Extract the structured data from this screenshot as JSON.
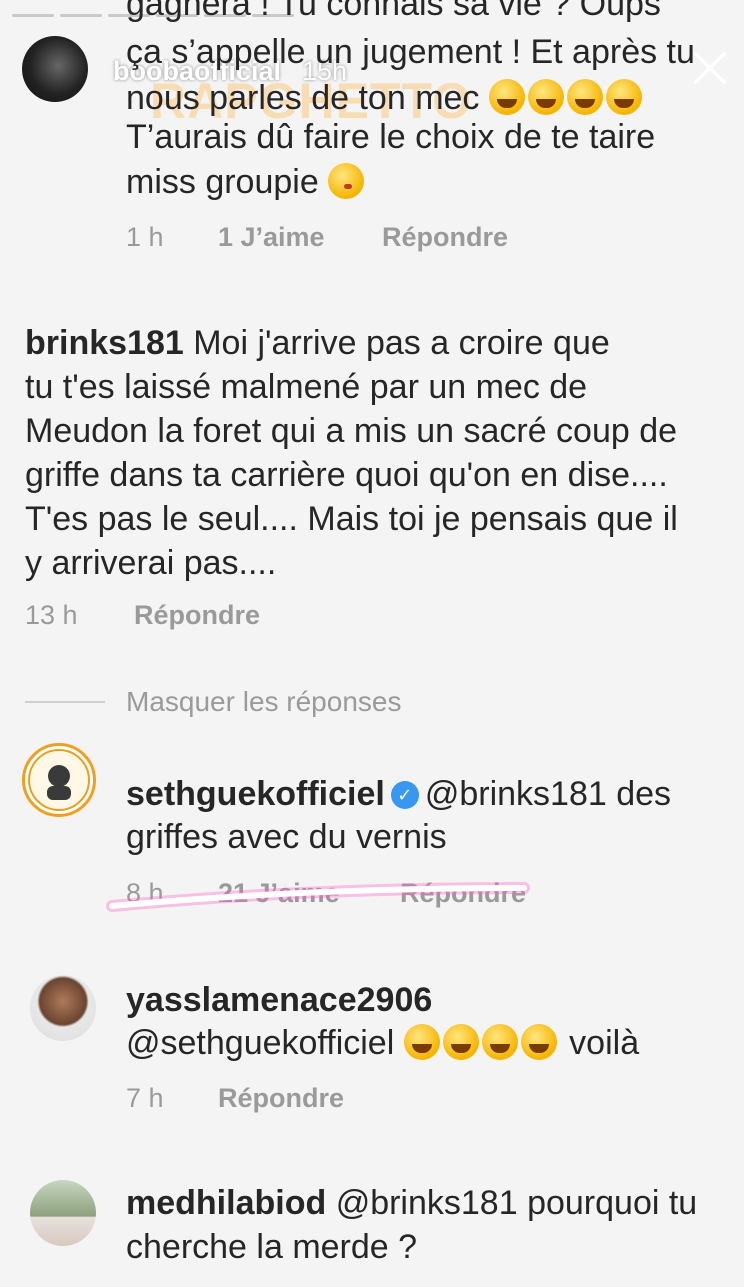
{
  "story": {
    "username": "boobaofficial",
    "time": "15h",
    "watermark": "RAPGHETTO"
  },
  "comment1": {
    "line0": "gagnera ! Tu connais sa vie ? Oups",
    "line1": "ça s’appelle un jugement ! Et après tu",
    "line2": "nous parles de ton mec",
    "line3": "T’aurais dû faire le choix de te taire",
    "line4": "miss groupie",
    "time": "1 h",
    "likes": "1 J’aime",
    "reply": "Répondre"
  },
  "comment2": {
    "user": "brinks181",
    "line1": "Moi j'arrive pas a croire que",
    "line2": "tu t'es laissé malmené par un mec de",
    "line3": "Meudon la foret qui a mis un sacré coup de",
    "line4": "griffe dans ta carrière quoi qu'on en dise....",
    "line5": "T'es pas le seul.... Mais toi je pensais que il",
    "line6": "y arriverai pas....",
    "time": "13 h",
    "reply": "Répondre"
  },
  "hide_replies": "Masquer les réponses",
  "reply1": {
    "user": "sethguekofficiel",
    "mention": "@brinks181",
    "text_a": "des",
    "text_b": "griffes avec du vernis",
    "time": "8 h",
    "likes": "21 J’aime",
    "reply": "Répondre",
    "highlight_color": "#ff5fc8"
  },
  "reply2": {
    "user": "yasslamenace2906",
    "mention": "@sethguekofficiel",
    "text": "voilà",
    "time": "7 h",
    "reply": "Répondre"
  },
  "reply3": {
    "user": "medhilabiod",
    "mention": "@brinks181",
    "text_a": "pourquoi tu",
    "text_b": "cherche la merde ?"
  },
  "icons": {
    "close": "close-icon",
    "verified": "verified-badge-icon",
    "emoji_laugh": "rolling-laughing-emoji",
    "emoji_kiss": "kissing-face-emoji"
  }
}
